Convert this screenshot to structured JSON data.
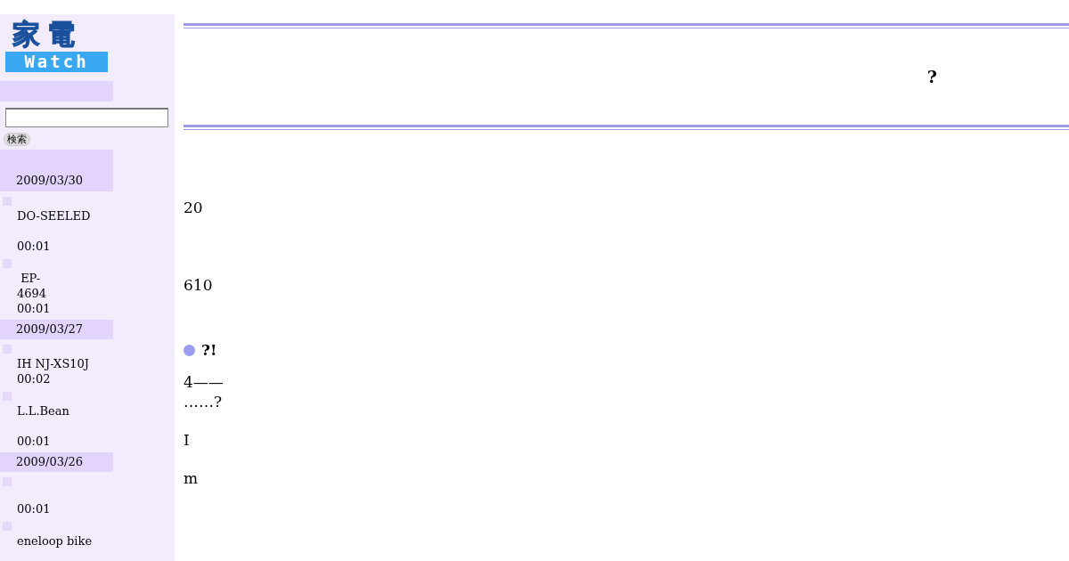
{
  "logo": {
    "top": "家電",
    "bottom": "Watch"
  },
  "search": {
    "button": "検索"
  },
  "sidebar": [
    {
      "kind": "date",
      "text": "2009/03/30"
    },
    {
      "kind": "article",
      "lines": [
        "DO-SEELED"
      ],
      "time": "00:01"
    },
    {
      "kind": "article",
      "lines": [
        " EP-",
        "4694"
      ],
      "time": "00:01"
    },
    {
      "kind": "date",
      "text": "2009/03/27"
    },
    {
      "kind": "article",
      "lines": [
        "IH NJ-XS10J"
      ],
      "time": "00:02"
    },
    {
      "kind": "article",
      "lines": [
        "L.L.Bean"
      ],
      "time": "00:01"
    },
    {
      "kind": "date",
      "text": "2009/03/26"
    },
    {
      "kind": "article",
      "time": "00:01"
    },
    {
      "kind": "article",
      "lines": [
        "eneloop bike"
      ]
    }
  ],
  "article": {
    "title": "?",
    "blocks": [
      {
        "kind": "para",
        "text": "20"
      },
      {
        "kind": "para",
        "text": "610"
      },
      {
        "kind": "heading",
        "text": "?!"
      },
      {
        "kind": "para",
        "text": "4——\n……?"
      },
      {
        "kind": "para",
        "text": "I"
      },
      {
        "kind": "para",
        "text": "m"
      }
    ]
  }
}
